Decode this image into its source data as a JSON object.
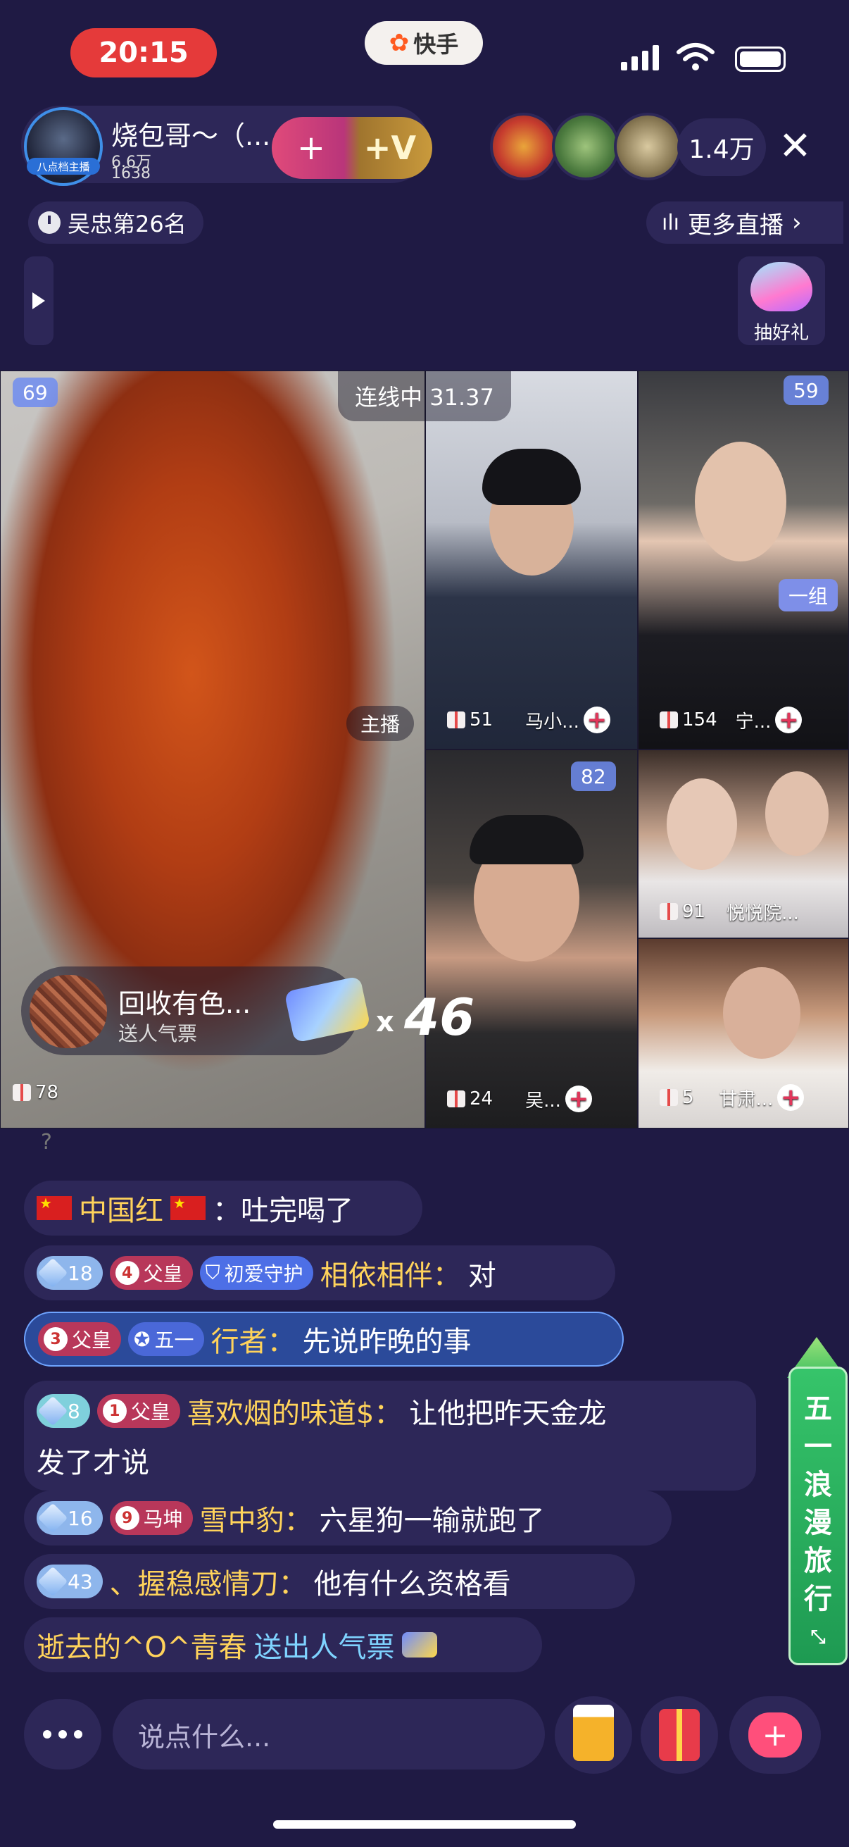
{
  "status_bar": {
    "time": "20:15",
    "app_badge": "快手"
  },
  "header": {
    "streamer_name": "烧包哥～（...",
    "stat_1": "6.6万",
    "stat_2": "1638",
    "avatar_tag": "八点档主播",
    "follow_plus": "+",
    "follow_v": "+V",
    "viewer_count": "1.4万",
    "rank_text": "吴忠第26名",
    "more_live": "更多直播",
    "lottery_label": "抽好礼"
  },
  "video": {
    "link_status": "连线中 31.37",
    "main_seat": "69",
    "main_gift_count": "78",
    "host_label": "主播",
    "promo_title": "回收有色...",
    "promo_subtitle": "送人气票",
    "combo_x": "x",
    "combo_count": "46",
    "tiles": [
      {
        "name": "马小...",
        "gifts": "51"
      },
      {
        "name": "宁...",
        "gifts": "154",
        "seat": "59"
      },
      {
        "name": "吴...",
        "gifts": "24",
        "seat": "82"
      },
      {
        "name": "悦悦院...",
        "gifts": "91"
      },
      {
        "name": "甘肃...",
        "gifts": "5",
        "group": "一组"
      }
    ]
  },
  "chat": [
    {
      "user": "中国红",
      "text": "吐完喝了"
    },
    {
      "level": "18",
      "badge": "4",
      "badge_label": "父皇",
      "guard": "初爱守护",
      "user": "相依相伴：",
      "text": "对"
    },
    {
      "badge": "3",
      "badge_label": "父皇",
      "event": "五一",
      "user": "行者：",
      "text": "先说昨晚的事"
    },
    {
      "level": "8",
      "badge": "1",
      "badge_label": "父皇",
      "user": "喜欢烟的味道$：",
      "text": "让他把昨天金龙",
      "text2": "发了才说"
    },
    {
      "level": "16",
      "badge": "9",
      "badge_label": "马坤",
      "user": "雪中豹：",
      "text": "六星狗一输就跑了"
    },
    {
      "level": "43",
      "user": "、握稳感情刀：",
      "text": "他有什么资格看"
    },
    {
      "user": "逝去的^O^青春",
      "text": "送出人气票"
    }
  ],
  "side_banner": [
    "五",
    "一",
    "浪",
    "漫",
    "旅",
    "行"
  ],
  "bottom_bar": {
    "input_placeholder": "说点什么..."
  }
}
